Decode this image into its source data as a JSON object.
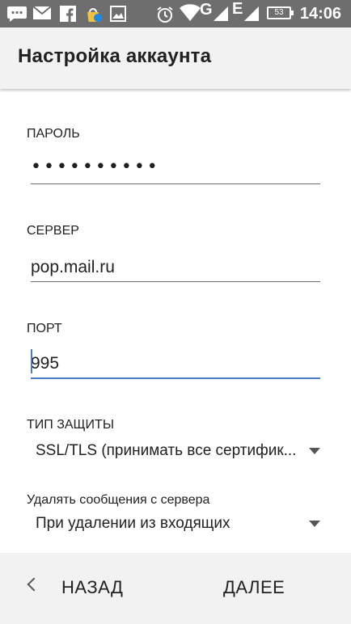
{
  "status_bar": {
    "time": "14:06",
    "battery": "53",
    "network_g": "G",
    "network_e": "E",
    "icons": [
      "chat-icon",
      "mail-icon",
      "facebook-icon",
      "app-icon",
      "image-icon",
      "alarm-icon",
      "wifi-icon",
      "signal-icon"
    ]
  },
  "appbar": {
    "title": "Настройка аккаунта"
  },
  "form": {
    "password": {
      "label": "ПАРОЛЬ",
      "value": "••••••••••"
    },
    "server": {
      "label": "СЕРВЕР",
      "value": "pop.mail.ru"
    },
    "port": {
      "label": "ПОРТ",
      "value": "995"
    },
    "security": {
      "label": "ТИП ЗАЩИТЫ",
      "value": "SSL/TLS (принимать все сертифик..."
    },
    "delete": {
      "label": "Удалять сообщения с сервера",
      "value": "При удалении из входящих"
    }
  },
  "bottom": {
    "back_label": "НАЗАД",
    "next_label": "ДАЛЕЕ"
  },
  "colors": {
    "accent": "#4a7cc3",
    "status_bar": "#6e6e6e",
    "app_bar": "#f2f2f2"
  }
}
